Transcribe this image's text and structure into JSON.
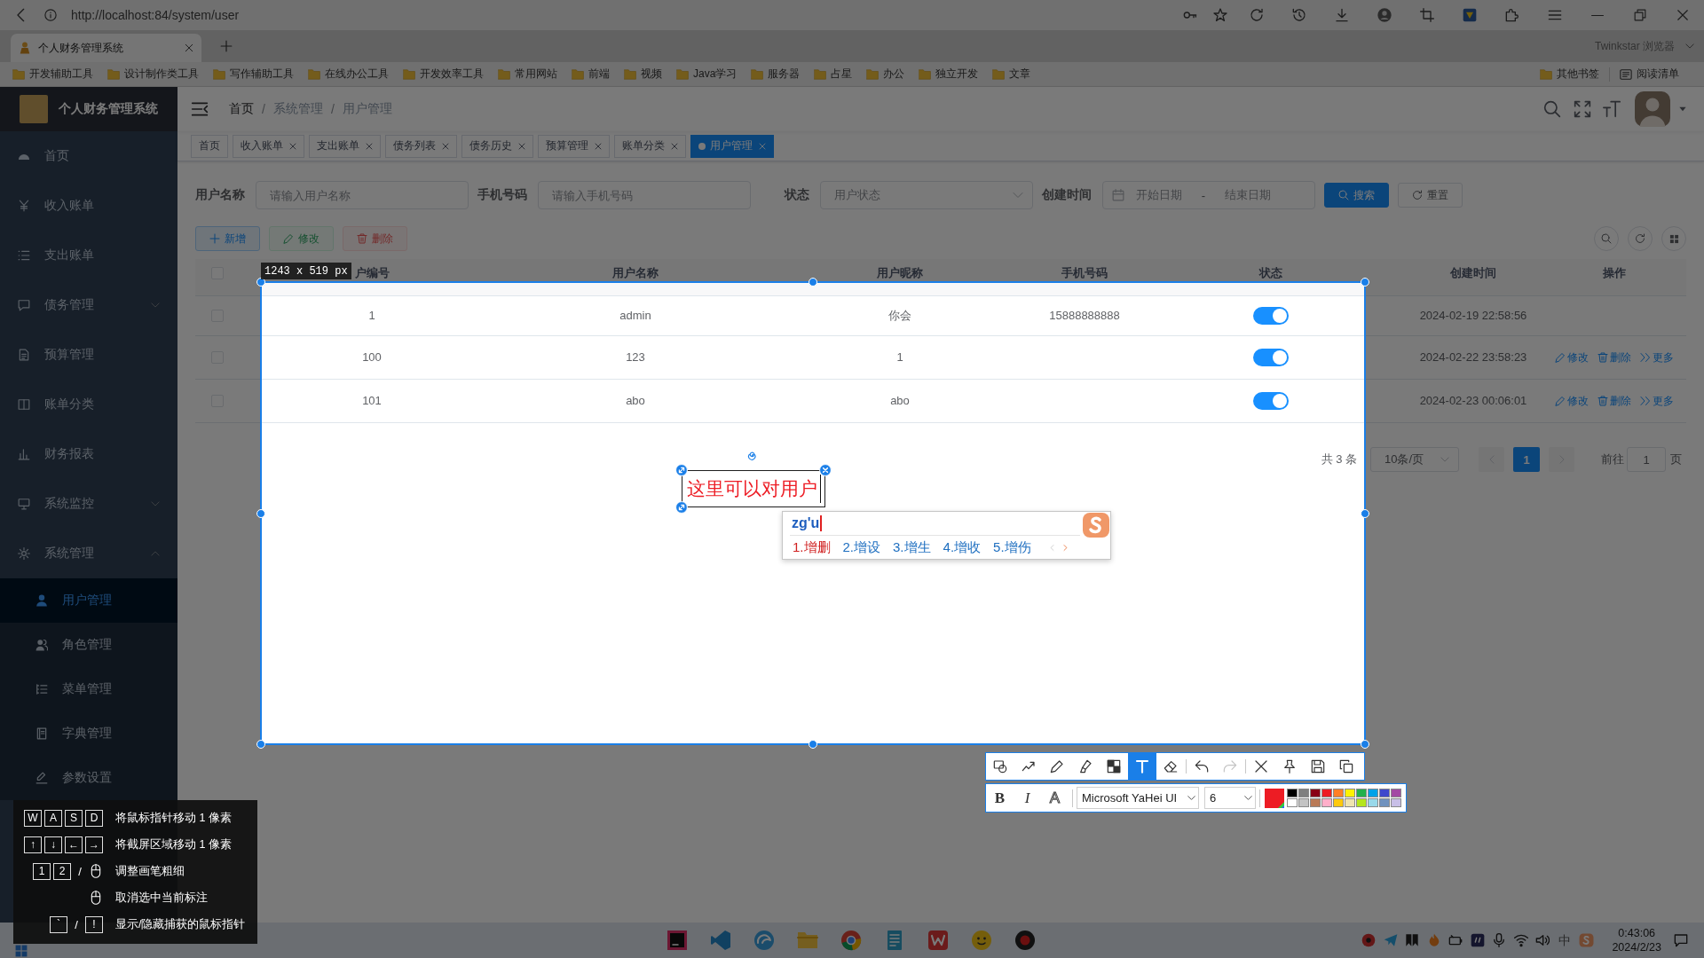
{
  "browser": {
    "url": "http://localhost:84/system/user",
    "tabs": [
      {
        "title": "个人财务管理系统",
        "selected": true
      }
    ],
    "profile_name": "Twinkstar 浏览器",
    "bookmarks": [
      "开发辅助工具",
      "设计制作类工具",
      "写作辅助工具",
      "在线办公工具",
      "开发效率工具",
      "常用网站",
      "前端",
      "视频",
      "Java学习",
      "服务器",
      "占星",
      "办公",
      "独立开发",
      "文章"
    ],
    "other_bookmarks": "其他书签",
    "reading_list": "阅读清单"
  },
  "sidebar": {
    "title": "个人财务管理系统",
    "items": [
      {
        "label": "首页",
        "kind": "link",
        "selected": false
      },
      {
        "label": "收入账单",
        "kind": "link",
        "selected": false
      },
      {
        "label": "支出账单",
        "kind": "link",
        "selected": false
      },
      {
        "label": "债务管理",
        "kind": "group",
        "expanded": false,
        "selected": false
      },
      {
        "label": "预算管理",
        "kind": "link",
        "selected": false
      },
      {
        "label": "账单分类",
        "kind": "link",
        "selected": false
      },
      {
        "label": "财务报表",
        "kind": "link",
        "selected": false
      },
      {
        "label": "系统监控",
        "kind": "group",
        "expanded": false,
        "selected": false
      },
      {
        "label": "系统管理",
        "kind": "group",
        "expanded": true,
        "selected": false,
        "children": [
          {
            "label": "用户管理",
            "selected": true
          },
          {
            "label": "角色管理",
            "selected": false
          },
          {
            "label": "菜单管理",
            "selected": false
          },
          {
            "label": "字典管理",
            "selected": false
          },
          {
            "label": "参数设置",
            "selected": false
          }
        ]
      }
    ]
  },
  "navbar": {
    "breadcrumb": [
      {
        "label": "首页",
        "kind": "link"
      },
      {
        "label": "系统管理",
        "kind": "text"
      },
      {
        "label": "用户管理",
        "kind": "text"
      }
    ],
    "separator": "/"
  },
  "tags": [
    {
      "label": "首页",
      "closable": false,
      "selected": false
    },
    {
      "label": "收入账单",
      "closable": true,
      "selected": false
    },
    {
      "label": "支出账单",
      "closable": true,
      "selected": false
    },
    {
      "label": "债务列表",
      "closable": true,
      "selected": false
    },
    {
      "label": "债务历史",
      "closable": true,
      "selected": false
    },
    {
      "label": "预算管理",
      "closable": true,
      "selected": false
    },
    {
      "label": "账单分类",
      "closable": true,
      "selected": false
    },
    {
      "label": "用户管理",
      "closable": true,
      "selected": true
    }
  ],
  "search_form": {
    "fields": [
      {
        "label": "用户名称",
        "kind": "input",
        "placeholder": "请输入用户名称"
      },
      {
        "label": "手机号码",
        "kind": "input",
        "placeholder": "请输入手机号码"
      },
      {
        "label": "状态",
        "kind": "select",
        "placeholder": "用户状态"
      },
      {
        "label": "创建时间",
        "kind": "daterange",
        "start_placeholder": "开始日期",
        "separator": "-",
        "end_placeholder": "结束日期"
      }
    ],
    "buttons": [
      {
        "label": "搜索",
        "kind": "primary"
      },
      {
        "label": "重置",
        "kind": "default"
      }
    ]
  },
  "toolbar": {
    "buttons": [
      {
        "label": "新增",
        "kind": "primary",
        "disabled": false
      },
      {
        "label": "修改",
        "kind": "success",
        "disabled": true
      },
      {
        "label": "删除",
        "kind": "danger",
        "disabled": true
      }
    ]
  },
  "table": {
    "header_checked": false,
    "columns": [
      "户编号",
      "用户名称",
      "用户昵称",
      "手机号码",
      "状态",
      "创建时间",
      "操作"
    ],
    "rows": [
      {
        "checked": false,
        "id": "1",
        "username": "admin",
        "nickname": "你会",
        "phone": "15888888888",
        "enabled": true,
        "created": "2024-02-19 22:58:56"
      },
      {
        "checked": false,
        "id": "100",
        "username": "123",
        "nickname": "1",
        "enabled": true,
        "created": "2024-02-22 23:58:23",
        "actions": [
          {
            "label": "修改",
            "kind": "edit"
          },
          {
            "label": "删除",
            "kind": "delete"
          },
          {
            "label": "更多",
            "kind": "more"
          }
        ]
      },
      {
        "checked": false,
        "id": "101",
        "username": "abo",
        "nickname": "abo",
        "enabled": true,
        "created": "2024-02-23 00:06:01",
        "actions": [
          {
            "label": "修改",
            "kind": "edit"
          },
          {
            "label": "删除",
            "kind": "delete"
          },
          {
            "label": "更多",
            "kind": "more"
          }
        ]
      }
    ]
  },
  "pagination": {
    "total": "共 3 条",
    "page_size": "10条/页",
    "previous": {
      "disabled": true
    },
    "pages": [
      {
        "label": "1",
        "selected": true
      }
    ],
    "next": {
      "disabled": true
    },
    "goto_label": "前往",
    "goto_value": "1",
    "goto_suffix": "页"
  },
  "capture": {
    "size_label": "1243 x 519 px"
  },
  "annotation": {
    "text": "这里可以对用户"
  },
  "ime": {
    "input": "zg'u",
    "candidates": [
      {
        "label": "1.增删",
        "selected": true
      },
      {
        "label": "2.增设",
        "selected": false
      },
      {
        "label": "3.增生",
        "selected": false
      },
      {
        "label": "4.增收",
        "selected": false
      },
      {
        "label": "5.增伤",
        "selected": false
      }
    ],
    "prev_page": {
      "disabled": true
    },
    "next_page": {
      "disabled": false
    }
  },
  "drawing_toolbar": {
    "tools": [
      {
        "kind": "shape",
        "selected": false
      },
      {
        "kind": "line",
        "selected": false
      },
      {
        "kind": "pencil",
        "selected": false
      },
      {
        "kind": "marker",
        "selected": false
      },
      {
        "kind": "mosaic",
        "selected": false
      },
      {
        "kind": "text",
        "selected": true
      },
      {
        "kind": "eraser",
        "selected": false
      }
    ],
    "history": [
      {
        "kind": "undo",
        "disabled": false
      },
      {
        "kind": "redo",
        "disabled": true
      }
    ],
    "actions": [
      {
        "kind": "close"
      },
      {
        "kind": "pin"
      },
      {
        "kind": "save"
      },
      {
        "kind": "copy"
      }
    ],
    "format_buttons": [
      {
        "label": "B",
        "kind": "bold",
        "selected": false
      },
      {
        "label": "I",
        "kind": "italic",
        "selected": false
      },
      {
        "label": "A",
        "kind": "outline",
        "selected": false
      }
    ],
    "font": "Microsoft YaHei UI",
    "size": "6",
    "current_color_swatch": {
      "color": "#ed1c24"
    },
    "palette": [
      {
        "color": "#000000"
      },
      {
        "color": "#7f7f7f"
      },
      {
        "color": "#880015"
      },
      {
        "color": "#ed1c24"
      },
      {
        "color": "#ff7f27"
      },
      {
        "color": "#fff200"
      },
      {
        "color": "#22b14c"
      },
      {
        "color": "#00a2e8"
      },
      {
        "color": "#3f48cc"
      },
      {
        "color": "#a349a4"
      },
      {
        "color": "#ffffff"
      },
      {
        "color": "#c3c3c3"
      },
      {
        "color": "#b97a57"
      },
      {
        "color": "#ffaec9"
      },
      {
        "color": "#ffc90e"
      },
      {
        "color": "#efe4b0"
      },
      {
        "color": "#b5e61d"
      },
      {
        "color": "#99d9ea"
      },
      {
        "color": "#7092be"
      },
      {
        "color": "#c8bfe7"
      }
    ]
  },
  "shortcuts": [
    {
      "keys": [
        {
          "kind": "key",
          "label": "W"
        },
        {
          "kind": "key",
          "label": "A"
        },
        {
          "kind": "key",
          "label": "S"
        },
        {
          "kind": "key",
          "label": "D"
        }
      ],
      "description": "将鼠标指针移动 1 像素"
    },
    {
      "keys": [
        {
          "kind": "key",
          "label": "↑"
        },
        {
          "kind": "key",
          "label": "↓"
        },
        {
          "kind": "key",
          "label": "←"
        },
        {
          "kind": "key",
          "label": "→"
        }
      ],
      "description": "将截屏区域移动 1 像素"
    },
    {
      "keys": [
        {
          "kind": "key",
          "label": "1"
        },
        {
          "kind": "key",
          "label": "2"
        },
        {
          "kind": "text",
          "label": "/"
        },
        {
          "kind": "mouse"
        }
      ],
      "description": "调整画笔粗细"
    },
    {
      "keys": [
        {
          "kind": "mouse"
        }
      ],
      "description": "取消选中当前标注"
    },
    {
      "keys": [
        {
          "kind": "key",
          "label": "`"
        },
        {
          "kind": "text",
          "label": "/"
        },
        {
          "kind": "key",
          "label": "!"
        }
      ],
      "description": "显示/隐藏捕获的鼠标指针"
    }
  ],
  "taskbar": {
    "ime_mode": "中",
    "time": "0:43:06",
    "date": "2024/2/23"
  }
}
